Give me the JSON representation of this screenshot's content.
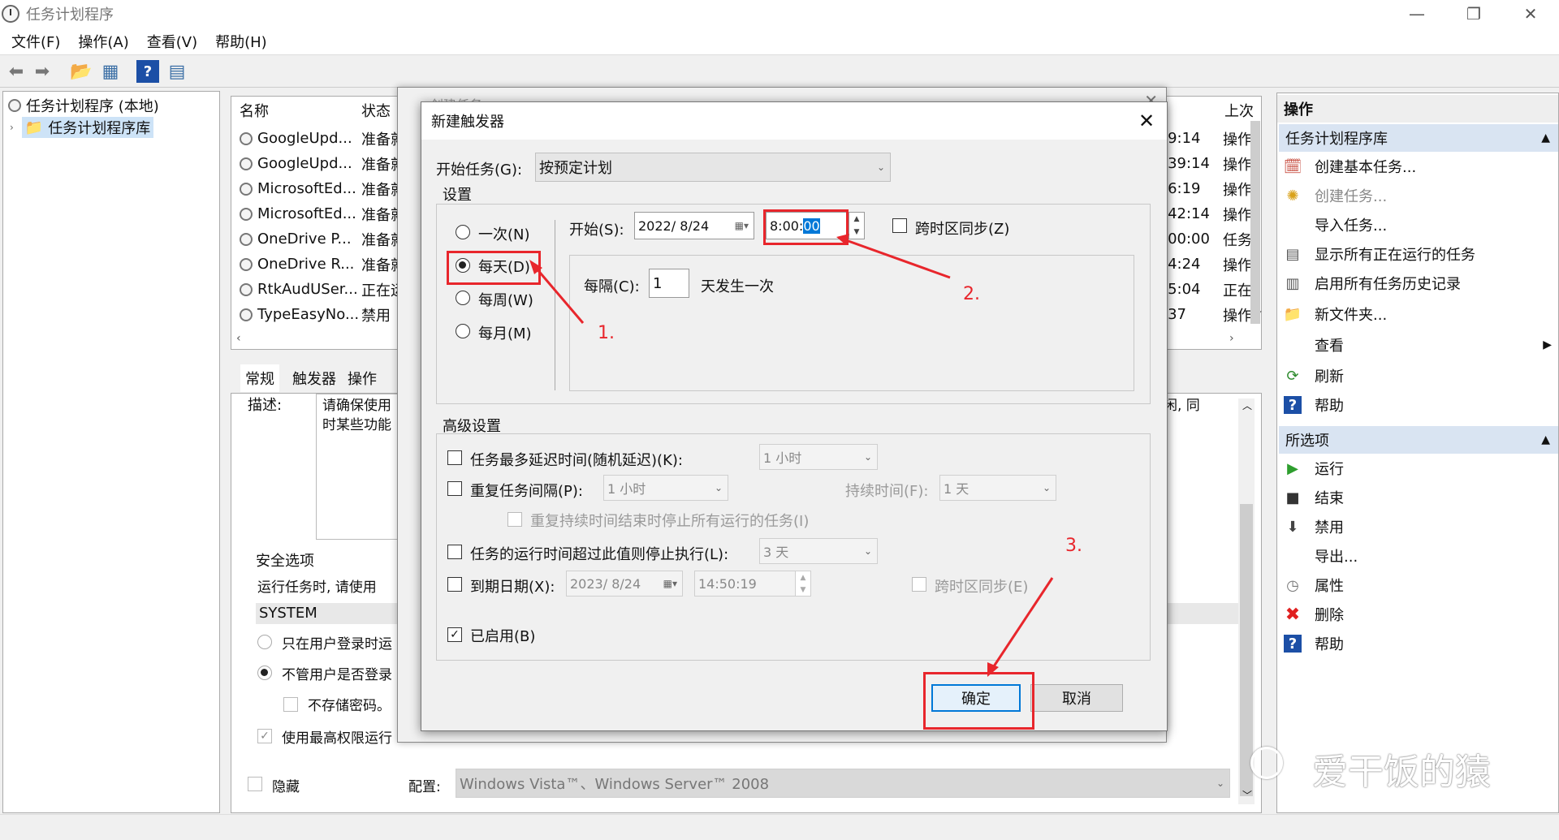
{
  "window": {
    "title": "任务计划程序",
    "minimize": "—",
    "maximize": "❐",
    "close": "✕"
  },
  "menu": [
    "文件(F)",
    "操作(A)",
    "查看(V)",
    "帮助(H)"
  ],
  "tree": {
    "root": "任务计划程序 (本地)",
    "child": "任务计划程序库"
  },
  "list": {
    "headers": {
      "name": "名称",
      "status": "状态",
      "trigger_partial": "上次"
    },
    "rows": [
      {
        "name": "GoogleUpd...",
        "status": "准备就",
        "time": ":9:14",
        "res": "操作"
      },
      {
        "name": "GoogleUpd...",
        "status": "准备就",
        "time": ":39:14",
        "res": "操作"
      },
      {
        "name": "MicrosoftEd...",
        "status": "准备就",
        "time": ":6:19",
        "res": "操作"
      },
      {
        "name": "MicrosoftEd...",
        "status": "准备就",
        "time": ":42:14",
        "res": "操作"
      },
      {
        "name": "OneDrive P...",
        "status": "准备就",
        "time": ":00:00",
        "res": "任务"
      },
      {
        "name": "OneDrive R...",
        "status": "准备就",
        "time": ":4:24",
        "res": "操作"
      },
      {
        "name": "RtkAudUSer...",
        "status": "正在运",
        "time": ":5:04",
        "res": "正在"
      },
      {
        "name": "TypeEasyNo...",
        "status": "禁用",
        "time": ":37",
        "res": "操作"
      }
    ]
  },
  "tabs": [
    "常规",
    "触发器",
    "操作"
  ],
  "details": {
    "desc_label": "描述:",
    "desc_text1": "请确保使用",
    "desc_text2": "时某些功能",
    "desc_right": "闲, 同",
    "security_title": "安全选项",
    "run_as": "运行任务时, 请使用",
    "account": "SYSTEM",
    "opt1": "只在用户登录时运",
    "opt2": "不管用户是否登录",
    "opt3": "不存储密码。",
    "opt4": "使用最高权限运行",
    "hidden": "隐藏",
    "config_label": "配置:",
    "config_value": "Windows Vista™、Windows Server™ 2008"
  },
  "actions": {
    "title": "操作",
    "section1": "任务计划程序库",
    "items1": [
      {
        "label": "创建基本任务...",
        "icon": "calendar-icon",
        "disabled": false
      },
      {
        "label": "创建任务...",
        "icon": "new-task-icon",
        "disabled": true
      },
      {
        "label": "导入任务...",
        "icon": "",
        "disabled": false
      },
      {
        "label": "显示所有正在运行的任务",
        "icon": "running-tasks-icon",
        "disabled": false
      },
      {
        "label": "启用所有任务历史记录",
        "icon": "history-icon",
        "disabled": false
      },
      {
        "label": "新文件夹...",
        "icon": "folder-icon",
        "disabled": false
      },
      {
        "label": "查看",
        "icon": "",
        "disabled": false
      },
      {
        "label": "刷新",
        "icon": "refresh-icon",
        "disabled": false
      },
      {
        "label": "帮助",
        "icon": "help-icon",
        "disabled": false
      }
    ],
    "section2": "所选项",
    "items2": [
      {
        "label": "运行",
        "icon": "play-icon"
      },
      {
        "label": "结束",
        "icon": "stop-icon"
      },
      {
        "label": "禁用",
        "icon": "disable-icon"
      },
      {
        "label": "导出...",
        "icon": ""
      },
      {
        "label": "属性",
        "icon": "properties-icon"
      },
      {
        "label": "删除",
        "icon": "delete-icon"
      },
      {
        "label": "帮助",
        "icon": "help-icon"
      }
    ]
  },
  "bg_dialog": {
    "title": "创建任务"
  },
  "dialog": {
    "title": "新建触发器",
    "start_task_label": "开始任务(G):",
    "start_task_value": "按预定计划",
    "settings_label": "设置",
    "radios": [
      "一次(N)",
      "每天(D)",
      "每周(W)",
      "每月(M)"
    ],
    "selected": "每天(D)",
    "start_label": "开始(S):",
    "start_date": "2022/ 8/24",
    "start_time_prefix": "8:00:",
    "start_time_selected": "00",
    "sync_tz": "跨时区同步(Z)",
    "every_label": "每隔(C):",
    "every_value": "1",
    "every_suffix": "天发生一次",
    "advanced_label": "高级设置",
    "delay_label": "任务最多延迟时间(随机延迟)(K):",
    "delay_value": "1 小时",
    "repeat_label": "重复任务间隔(P):",
    "repeat_value": "1 小时",
    "duration_label": "持续时间(F):",
    "duration_value": "1 天",
    "stop_all_label": "重复持续时间结束时停止所有运行的任务(I)",
    "stop_if_label": "任务的运行时间超过此值则停止执行(L):",
    "stop_if_value": "3 天",
    "expire_label": "到期日期(X):",
    "expire_date": "2023/ 8/24",
    "expire_time": "14:50:19",
    "expire_sync": "跨时区同步(E)",
    "enabled_label": "已启用(B)",
    "ok": "确定",
    "cancel": "取消"
  },
  "annotations": [
    "1.",
    "2.",
    "3."
  ],
  "watermark": "爱干饭的猿",
  "colors": {
    "annotation": "#e8262c",
    "section_bg": "#d9e4f2",
    "selection": "#0078d7"
  }
}
